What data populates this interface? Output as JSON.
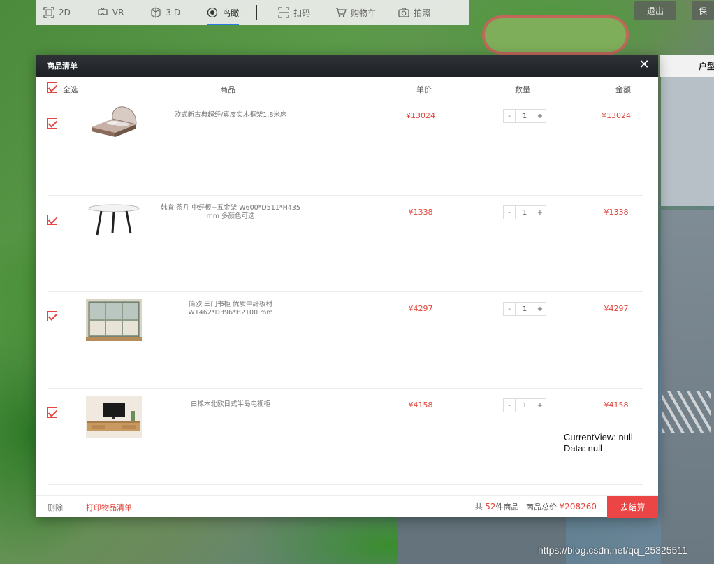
{
  "toolbar": {
    "items": [
      {
        "label": "2D",
        "icon": "frame-icon",
        "active": false
      },
      {
        "label": "VR",
        "icon": "vr-headset-icon",
        "active": false
      },
      {
        "label": "3 D",
        "icon": "cube-icon",
        "active": false
      },
      {
        "label": "鸟瞰",
        "icon": "aerial-view-icon",
        "active": true
      },
      {
        "label": "扫码",
        "icon": "scan-icon",
        "active": false
      },
      {
        "label": "购物车",
        "icon": "cart-icon",
        "active": false
      },
      {
        "label": "拍照",
        "icon": "camera-icon",
        "active": false
      }
    ],
    "exit_label": "退出",
    "save_label": "保"
  },
  "side_panel": {
    "title": "户型"
  },
  "modal": {
    "title": "商品清单",
    "close_icon": "close-icon",
    "columns": {
      "select_all": "全选",
      "product": "商品",
      "unit_price": "单价",
      "quantity": "数量",
      "amount": "金额"
    },
    "items": [
      {
        "name": "欧式新古典超纤/真皮实木框架1.8米床",
        "price": "¥13024",
        "quantity": "1",
        "amount": "¥13024",
        "checked": true,
        "thumb": "bed-image"
      },
      {
        "name": "韩宜 茶几 中纤板+五金架 W600*D511*H435 mm 多颜色可选",
        "price": "¥1338",
        "quantity": "1",
        "amount": "¥1338",
        "checked": true,
        "thumb": "coffee-table-image"
      },
      {
        "name": "简欧 三门书柜 优质中纤板材 W1462*D396*H2100 mm",
        "price": "¥4297",
        "quantity": "1",
        "amount": "¥4297",
        "checked": true,
        "thumb": "bookcase-image"
      },
      {
        "name": "白橡木北欧日式半岛电视柜",
        "price": "¥4158",
        "quantity": "1",
        "amount": "¥4158",
        "checked": true,
        "thumb": "tv-cabinet-image"
      }
    ],
    "qty_minus": "-",
    "qty_plus": "+",
    "footer": {
      "delete_label": "删除",
      "print_label": "打印物品清单",
      "count_prefix": "共",
      "count": "52",
      "count_suffix": "件商品",
      "total_label": "商品总价",
      "total": "¥208260",
      "checkout_label": "去结算"
    }
  },
  "debug": {
    "line1": "CurrentView: null",
    "line2": "Data: null"
  },
  "watermark": "https://blog.csdn.net/qq_25325511",
  "colors": {
    "accent": "#e2463e",
    "checkout": "#ec4545",
    "header": "#1d2125",
    "active_tab": "#2a7be4"
  }
}
